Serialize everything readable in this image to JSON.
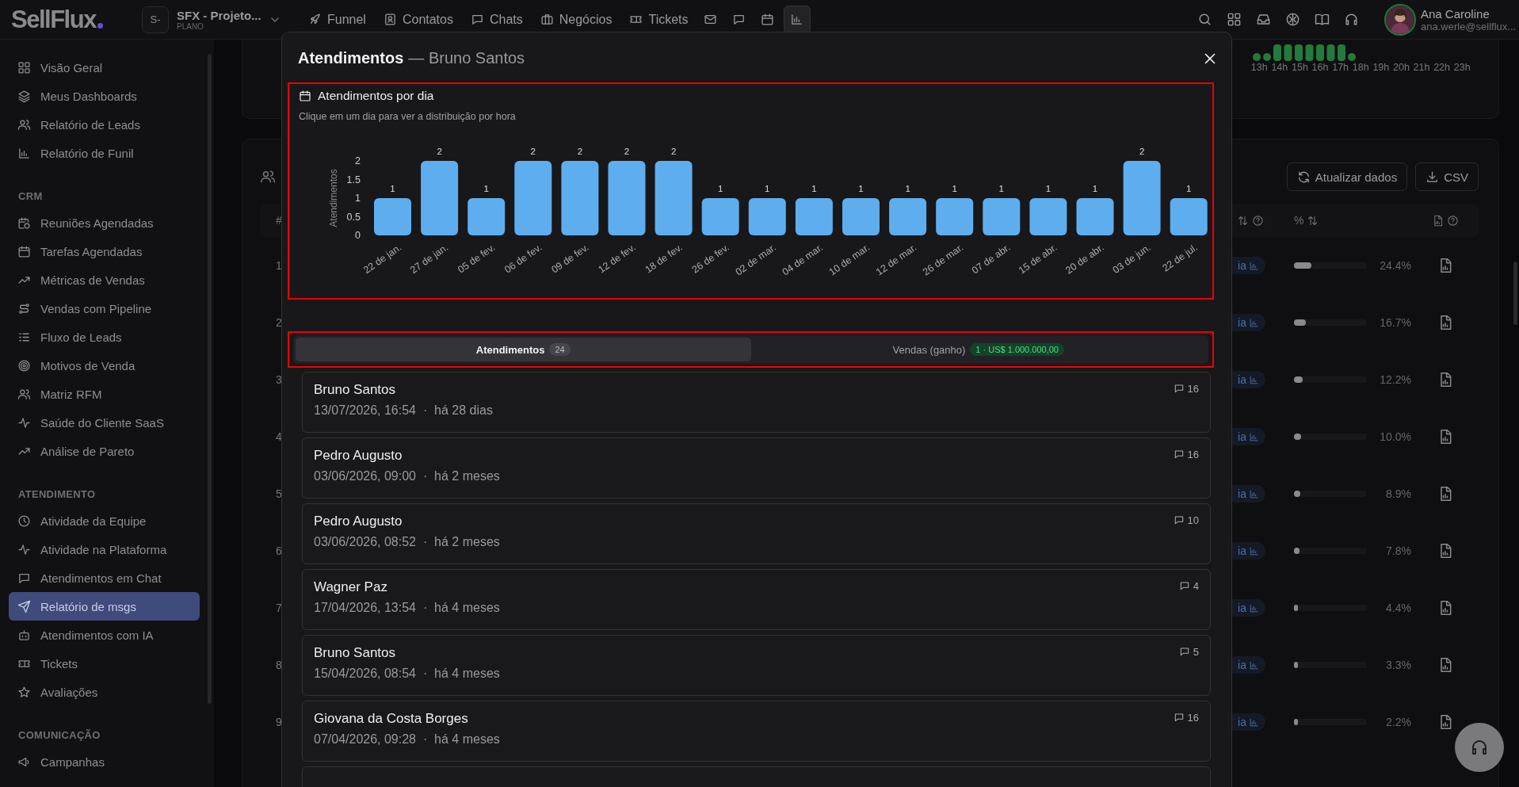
{
  "topbar": {
    "logo": "SellFlux",
    "workspace": {
      "avatar": "S-",
      "name": "SFX - Projeto...",
      "plan": "PLANO"
    },
    "nav": [
      {
        "label": "Funnel",
        "selected": false
      },
      {
        "label": "Contatos",
        "selected": false
      },
      {
        "label": "Chats",
        "selected": false
      },
      {
        "label": "Negócios",
        "selected": false
      },
      {
        "label": "Tickets",
        "selected": false
      }
    ],
    "nav_icons": [
      {
        "selected": false
      },
      {
        "selected": false
      },
      {
        "selected": false
      },
      {
        "selected": true
      }
    ],
    "user": {
      "name": "Ana Caroline",
      "email": "ana.werle@sellflux..."
    }
  },
  "sidebar": {
    "groups": [
      {
        "items": [
          {
            "label": "Visão Geral",
            "selected": false
          },
          {
            "label": "Meus Dashboards",
            "selected": false
          },
          {
            "label": "Relatório de Leads",
            "selected": false
          },
          {
            "label": "Relatório de Funil",
            "selected": false
          }
        ]
      },
      {
        "title": "CRM",
        "items": [
          {
            "label": "Reuniões Agendadas",
            "selected": false
          },
          {
            "label": "Tarefas Agendadas",
            "selected": false
          },
          {
            "label": "Métricas de Vendas",
            "selected": false
          },
          {
            "label": "Vendas com Pipeline",
            "selected": false
          },
          {
            "label": "Fluxo de Leads",
            "selected": false
          },
          {
            "label": "Motivos de Venda",
            "selected": false
          },
          {
            "label": "Matriz RFM",
            "selected": false
          },
          {
            "label": "Saúde do Cliente SaaS",
            "selected": false
          },
          {
            "label": "Análise de Pareto",
            "selected": false
          }
        ]
      },
      {
        "title": "ATENDIMENTO",
        "items": [
          {
            "label": "Atividade da Equipe",
            "selected": false
          },
          {
            "label": "Atividade na Plataforma",
            "selected": false
          },
          {
            "label": "Atendimentos em Chat",
            "selected": false
          },
          {
            "label": "Relatório de msgs",
            "selected": true
          },
          {
            "label": "Atendimentos com IA",
            "selected": false
          },
          {
            "label": "Tickets",
            "selected": false
          },
          {
            "label": "Avaliações",
            "selected": false
          }
        ]
      },
      {
        "title": "COMUNICAÇÃO",
        "items": [
          {
            "label": "Campanhas",
            "selected": false
          }
        ]
      }
    ]
  },
  "background": {
    "hours": [
      "13h",
      "14h",
      "15h",
      "16h",
      "17h",
      "18h",
      "19h",
      "20h",
      "21h",
      "22h",
      "23h"
    ],
    "buttons": [
      "Atualizar dados",
      "CSV"
    ],
    "table": {
      "number_header": "#",
      "percent_header": "%",
      "rows": [
        {
          "number": "1",
          "badge": "ia",
          "level": 0.244,
          "percent": "24.4%"
        },
        {
          "number": "2",
          "badge": "ia",
          "level": 0.167,
          "percent": "16.7%"
        },
        {
          "number": "3",
          "badge": "ia",
          "level": 0.122,
          "percent": "12.2%"
        },
        {
          "number": "4",
          "badge": "ia",
          "level": 0.1,
          "percent": "10.0%"
        },
        {
          "number": "5",
          "badge": "ia",
          "level": 0.089,
          "percent": "8.9%"
        },
        {
          "number": "6",
          "badge": "ia",
          "level": 0.078,
          "percent": "7.8%"
        },
        {
          "number": "7",
          "badge": "ia",
          "level": 0.044,
          "percent": "4.4%"
        },
        {
          "number": "8",
          "badge": "ia",
          "level": 0.033,
          "percent": "3.3%"
        },
        {
          "number": "9",
          "badge": "ia",
          "level": 0.022,
          "percent": "2.2%"
        }
      ]
    }
  },
  "modal": {
    "title": "Atendimentos",
    "subtitle": "— Bruno Santos",
    "chart_panel": {
      "title": "Atendimentos por dia",
      "hint": "Clique em um dia para ver a distribuição por hora",
      "chart_data": {
        "type": "bar",
        "ylabel": "Atendimentos",
        "categories": [
          "22 de jan.",
          "27 de jan.",
          "05 de fev.",
          "06 de fev.",
          "09 de fev.",
          "12 de fev.",
          "18 de fev.",
          "26 de fev.",
          "02 de mar.",
          "04 de mar.",
          "10 de mar.",
          "12 de mar.",
          "26 de mar.",
          "07 de abr.",
          "15 de abr.",
          "20 de abr.",
          "03 de jun.",
          "22 de jul."
        ],
        "values": [
          1,
          2,
          1,
          2,
          2,
          2,
          2,
          1,
          1,
          1,
          1,
          1,
          1,
          1,
          1,
          1,
          2,
          1
        ],
        "ylim": [
          0,
          2
        ],
        "yticks": [
          0,
          {
            "value": 0.5,
            "label": "0.5"
          },
          1,
          {
            "value": 1.5,
            "label": "1.5"
          },
          2
        ],
        "data_labels": true
      }
    },
    "tabs": [
      {
        "label": "Atendimentos",
        "badge": "24",
        "kind": "neutral",
        "selected": true
      },
      {
        "label": "Vendas (ganho)",
        "badge": "1 · US$ 1.000.000,00",
        "kind": "success",
        "selected": false
      }
    ],
    "items": [
      {
        "name": "Bruno Santos",
        "meta": "13/07/2026, 16:54  ·  há 28 dias",
        "messages": "16"
      },
      {
        "name": "Pedro Augusto",
        "meta": "03/06/2026, 09:00  ·  há 2 meses",
        "messages": "16"
      },
      {
        "name": "Pedro Augusto",
        "meta": "03/06/2026, 08:52  ·  há 2 meses",
        "messages": "10"
      },
      {
        "name": "Wagner Paz",
        "meta": "17/04/2026, 13:54  ·  há 4 meses",
        "messages": "4"
      },
      {
        "name": "Bruno Santos",
        "meta": "15/04/2026, 08:54  ·  há 4 meses",
        "messages": "5"
      },
      {
        "name": "Giovana da Costa Borges",
        "meta": "07/04/2026, 09:28  ·  há 4 meses",
        "messages": "16"
      }
    ]
  }
}
